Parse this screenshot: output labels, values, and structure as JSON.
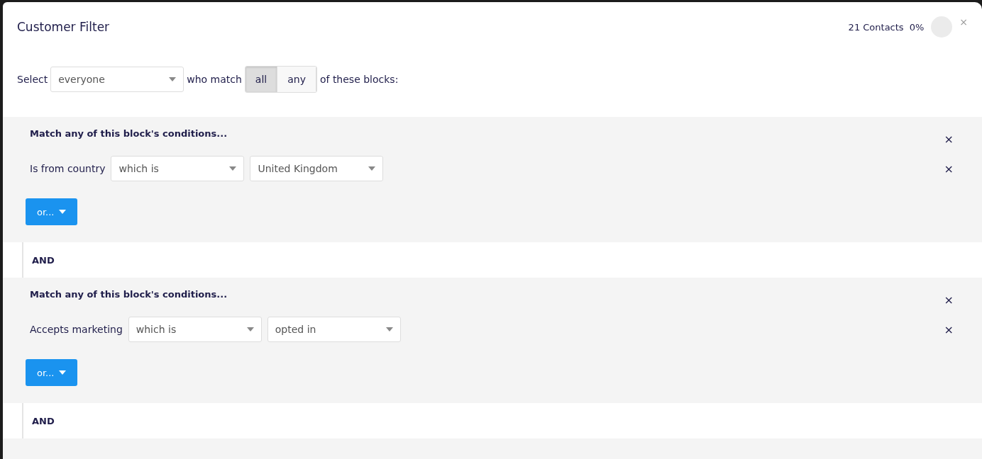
{
  "dialog": {
    "title": "Customer Filter",
    "contacts": "21 Contacts",
    "percent": "0%",
    "close": "×"
  },
  "selector": {
    "label": "Select",
    "audience": "everyone",
    "middle": "who match",
    "options": [
      {
        "label": "all",
        "selected": true
      },
      {
        "label": "any",
        "selected": false
      }
    ],
    "suffix": "of these blocks:"
  },
  "blocks": [
    {
      "heading": "Match any of this block's conditions...",
      "remove": "×",
      "conditions": [
        {
          "field": "Is from country",
          "operator": "which is",
          "value": "United Kingdom",
          "remove": "×"
        }
      ],
      "or_button": "or...",
      "joiner": "AND"
    },
    {
      "heading": "Match any of this block's conditions...",
      "remove": "×",
      "conditions": [
        {
          "field": "Accepts marketing",
          "operator": "which is",
          "value": "opted in",
          "remove": "×"
        }
      ],
      "or_button": "or...",
      "joiner": "AND"
    }
  ]
}
